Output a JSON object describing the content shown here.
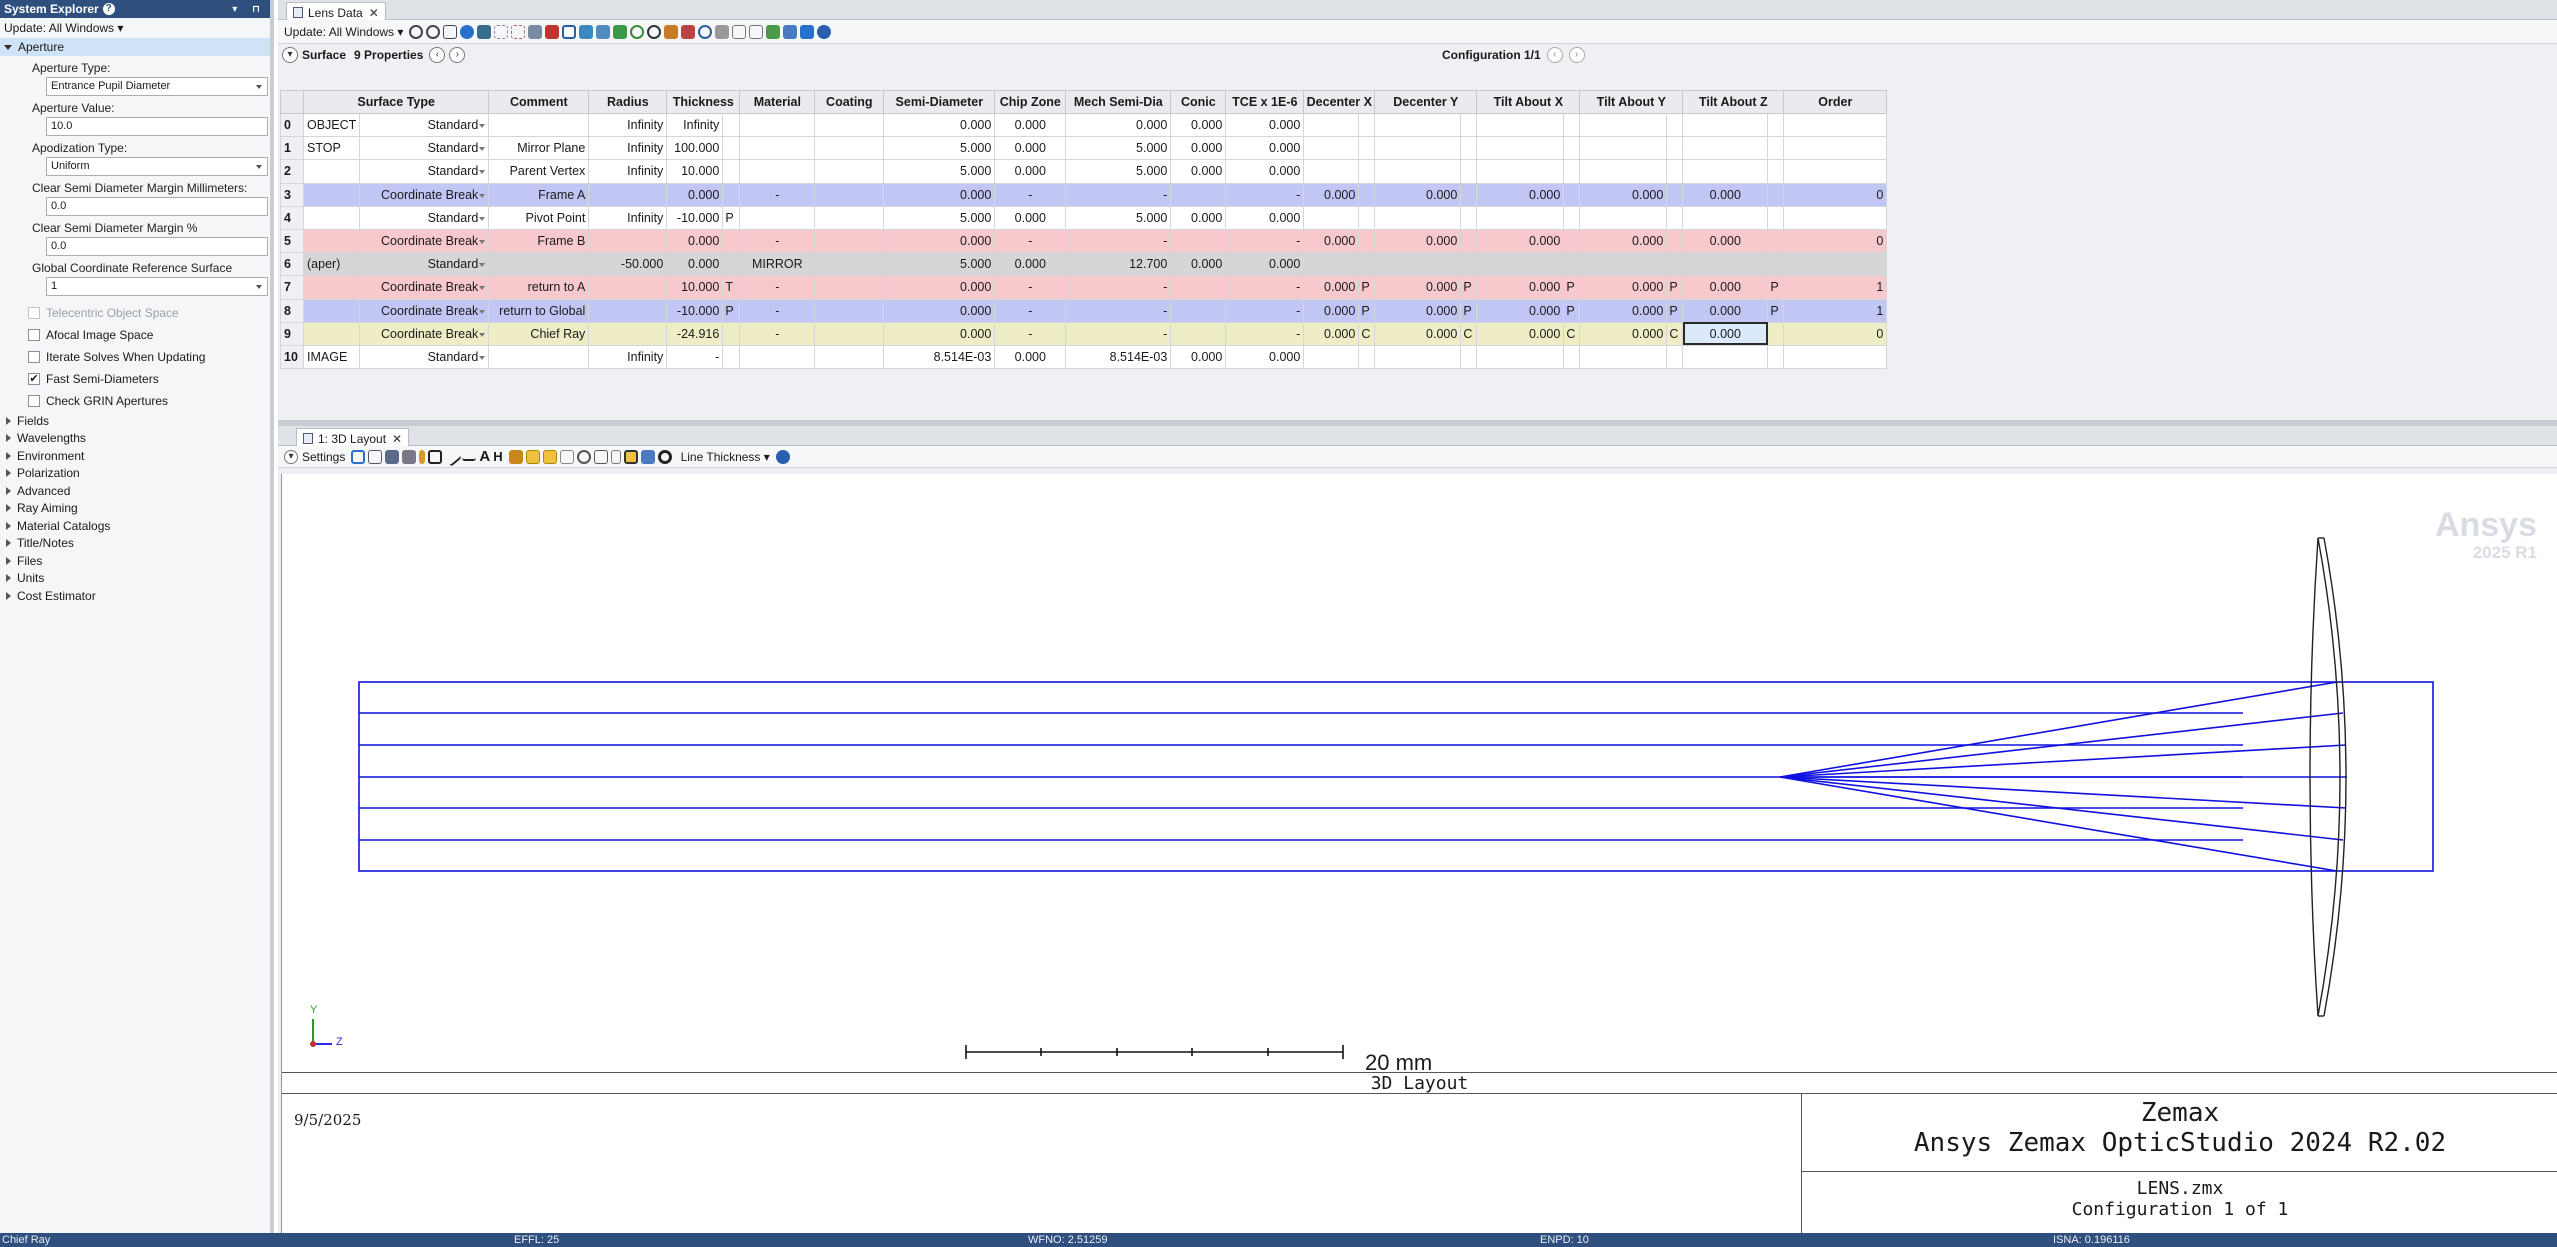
{
  "system_explorer": {
    "title": "System Explorer",
    "update": "Update: All Windows ▾",
    "aperture_header": "Aperture",
    "aperture_type_label": "Aperture Type:",
    "aperture_type_value": "Entrance Pupil Diameter",
    "aperture_value_label": "Aperture Value:",
    "aperture_value": "10.0",
    "apodization_label": "Apodization Type:",
    "apodization_value": "Uniform",
    "clear_mm_label": "Clear Semi Diameter Margin Millimeters:",
    "clear_mm_value": "0.0",
    "clear_pct_label": "Clear Semi Diameter Margin %",
    "clear_pct_value": "0.0",
    "gcrs_label": "Global Coordinate Reference Surface",
    "gcrs_value": "1",
    "checkboxes": [
      {
        "label": "Telecentric Object Space",
        "checked": false,
        "disabled": true
      },
      {
        "label": "Afocal Image Space",
        "checked": false,
        "disabled": false
      },
      {
        "label": "Iterate Solves When Updating",
        "checked": false,
        "disabled": false
      },
      {
        "label": "Fast Semi-Diameters",
        "checked": true,
        "disabled": false
      },
      {
        "label": "Check GRIN Apertures",
        "checked": false,
        "disabled": false
      }
    ],
    "groups": [
      "Fields",
      "Wavelengths",
      "Environment",
      "Polarization",
      "Advanced",
      "Ray Aiming",
      "Material Catalogs",
      "Title/Notes",
      "Files",
      "Units",
      "Cost Estimator"
    ]
  },
  "lens_data": {
    "tab": "Lens Data",
    "update": "Update: All Windows ▾",
    "surface_label": "Surface",
    "properties_label": "9 Properties",
    "configuration": "Configuration 1/1",
    "columns": [
      "Surface Type",
      "Comment",
      "Radius",
      "Thickness",
      "Material",
      "Coating",
      "Semi-Diameter",
      "Chip Zone",
      "Mech Semi-Dia",
      "Conic",
      "TCE x 1E-6",
      "Decenter X",
      "Decenter Y",
      "Tilt About X",
      "Tilt About Y",
      "Tilt About Z",
      "Order"
    ],
    "rows": [
      {
        "num": "0",
        "name": "OBJECT",
        "type": "Standard",
        "comment": "",
        "radius": "Infinity",
        "thickness": "Infinity",
        "th_solve": "",
        "material": "",
        "coating": "",
        "semi": "0.000",
        "chip": "0.000",
        "mech": "0.000",
        "conic": "0.000",
        "tce": "0.000",
        "dx": "",
        "dx_s": "",
        "dy": "",
        "dy_s": "",
        "tx": "",
        "tx_s": "",
        "ty": "",
        "ty_s": "",
        "tz": "",
        "tz_s": "",
        "order": ""
      },
      {
        "num": "1",
        "name": "STOP",
        "type": "Standard",
        "comment": "Mirror Plane",
        "radius": "Infinity",
        "thickness": "100.000",
        "th_solve": "",
        "material": "",
        "coating": "",
        "semi": "5.000",
        "chip": "0.000",
        "mech": "5.000",
        "conic": "0.000",
        "tce": "0.000",
        "dx": "",
        "dx_s": "",
        "dy": "",
        "dy_s": "",
        "tx": "",
        "tx_s": "",
        "ty": "",
        "ty_s": "",
        "tz": "",
        "tz_s": "",
        "order": ""
      },
      {
        "num": "2",
        "name": "",
        "type": "Standard",
        "comment": "Parent Vertex",
        "radius": "Infinity",
        "thickness": "10.000",
        "th_solve": "",
        "material": "",
        "coating": "",
        "semi": "5.000",
        "chip": "0.000",
        "mech": "5.000",
        "conic": "0.000",
        "tce": "0.000",
        "dx": "",
        "dx_s": "",
        "dy": "",
        "dy_s": "",
        "tx": "",
        "tx_s": "",
        "ty": "",
        "ty_s": "",
        "tz": "",
        "tz_s": "",
        "order": ""
      },
      {
        "num": "3",
        "name": "",
        "type": "Coordinate Break",
        "comment": "Frame A",
        "radius": "",
        "thickness": "0.000",
        "th_solve": "",
        "material": "-",
        "coating": "",
        "semi": "0.000",
        "chip": "-",
        "mech": "-",
        "conic": "",
        "tce": "-",
        "dx": "0.000",
        "dx_s": "",
        "dy": "0.000",
        "dy_s": "",
        "tx": "0.000",
        "tx_s": "",
        "ty": "0.000",
        "ty_s": "",
        "tz": "0.000",
        "tz_s": "",
        "order": "0"
      },
      {
        "num": "4",
        "name": "",
        "type": "Standard",
        "comment": "Pivot Point",
        "radius": "Infinity",
        "thickness": "-10.000",
        "th_solve": "P",
        "material": "",
        "coating": "",
        "semi": "5.000",
        "chip": "0.000",
        "mech": "5.000",
        "conic": "0.000",
        "tce": "0.000",
        "dx": "",
        "dx_s": "",
        "dy": "",
        "dy_s": "",
        "tx": "",
        "tx_s": "",
        "ty": "",
        "ty_s": "",
        "tz": "",
        "tz_s": "",
        "order": ""
      },
      {
        "num": "5",
        "name": "",
        "type": "Coordinate Break",
        "comment": "Frame B",
        "radius": "",
        "thickness": "0.000",
        "th_solve": "",
        "material": "-",
        "coating": "",
        "semi": "0.000",
        "chip": "-",
        "mech": "-",
        "conic": "",
        "tce": "-",
        "dx": "0.000",
        "dx_s": "",
        "dy": "0.000",
        "dy_s": "",
        "tx": "0.000",
        "tx_s": "",
        "ty": "0.000",
        "ty_s": "",
        "tz": "0.000",
        "tz_s": "",
        "order": "0"
      },
      {
        "num": "6",
        "name": "(aper)",
        "type": "Standard",
        "comment": "",
        "radius": "-50.000",
        "thickness": "0.000",
        "th_solve": "",
        "material": "MIRROR",
        "coating": "",
        "semi": "5.000",
        "chip": "0.000",
        "mech": "12.700",
        "conic": "0.000",
        "tce": "0.000",
        "dx": "",
        "dx_s": "",
        "dy": "",
        "dy_s": "",
        "tx": "",
        "tx_s": "",
        "ty": "",
        "ty_s": "",
        "tz": "",
        "tz_s": "",
        "order": ""
      },
      {
        "num": "7",
        "name": "",
        "type": "Coordinate Break",
        "comment": "return to A",
        "radius": "",
        "thickness": "10.000",
        "th_solve": "T",
        "material": "-",
        "coating": "",
        "semi": "0.000",
        "chip": "-",
        "mech": "-",
        "conic": "",
        "tce": "-",
        "dx": "0.000",
        "dx_s": "P",
        "dy": "0.000",
        "dy_s": "P",
        "tx": "0.000",
        "tx_s": "P",
        "ty": "0.000",
        "ty_s": "P",
        "tz": "0.000",
        "tz_s": "P",
        "order": "1"
      },
      {
        "num": "8",
        "name": "",
        "type": "Coordinate Break",
        "comment": "return to Global",
        "radius": "",
        "thickness": "-10.000",
        "th_solve": "P",
        "material": "-",
        "coating": "",
        "semi": "0.000",
        "chip": "-",
        "mech": "-",
        "conic": "",
        "tce": "-",
        "dx": "0.000",
        "dx_s": "P",
        "dy": "0.000",
        "dy_s": "P",
        "tx": "0.000",
        "tx_s": "P",
        "ty": "0.000",
        "ty_s": "P",
        "tz": "0.000",
        "tz_s": "P",
        "order": "1"
      },
      {
        "num": "9",
        "name": "",
        "type": "Coordinate Break",
        "comment": "Chief Ray",
        "radius": "",
        "thickness": "-24.916",
        "th_solve": "",
        "material": "-",
        "coating": "",
        "semi": "0.000",
        "chip": "-",
        "mech": "-",
        "conic": "",
        "tce": "-",
        "dx": "0.000",
        "dx_s": "C",
        "dy": "0.000",
        "dy_s": "C",
        "tx": "0.000",
        "tx_s": "C",
        "ty": "0.000",
        "ty_s": "C",
        "tz": "0.000",
        "tz_s": "",
        "order": "0"
      },
      {
        "num": "10",
        "name": "IMAGE",
        "type": "Standard",
        "comment": "",
        "radius": "Infinity",
        "thickness": "-",
        "th_solve": "",
        "material": "",
        "coating": "",
        "semi": "8.514E-03",
        "chip": "0.000",
        "mech": "8.514E-03",
        "conic": "0.000",
        "tce": "0.000",
        "dx": "",
        "dx_s": "",
        "dy": "",
        "dy_s": "",
        "tx": "",
        "tx_s": "",
        "ty": "",
        "ty_s": "",
        "tz": "",
        "tz_s": "",
        "order": ""
      }
    ]
  },
  "layout": {
    "tab": "1: 3D Layout",
    "settings_label": "Settings",
    "line_thickness_label": "Line Thickness ▾",
    "watermark": "Ansys",
    "watermark_sub": "2025 R1",
    "scale_label": "20 mm",
    "axis_y": "Y",
    "axis_z": "Z",
    "plot_title": "3D Layout",
    "date": "9/5/2025",
    "company": "Zemax",
    "product": "Ansys Zemax OpticStudio 2024 R2.02",
    "file": "LENS.zmx",
    "config": "Configuration 1 of 1"
  },
  "status_bar": {
    "item1": "Chief Ray",
    "effl": "EFFL: 25",
    "wfno": "WFNO: 2.51259",
    "enpd": "ENPD: 10",
    "isna": "ISNA: 0.196116"
  },
  "colors": {
    "coord_break_blue": "#c2c6f5",
    "coord_break_pink": "#f7c9cc",
    "aperture_gray": "#d6d6d6",
    "chief_ray_yellow": "#efedc6",
    "ray_color": "#1010e0",
    "title_bar": "#2f4f7f"
  }
}
